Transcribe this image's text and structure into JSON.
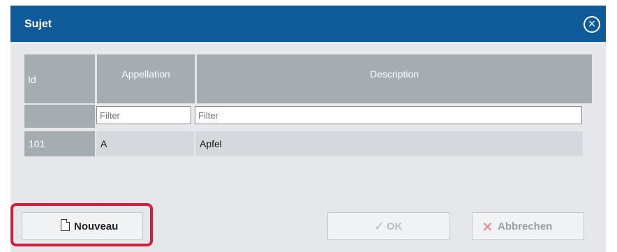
{
  "dialog": {
    "title": "Sujet",
    "close_icon": "close-circle-icon"
  },
  "table": {
    "columns": [
      "Id",
      "Appellation",
      "Description"
    ],
    "filters": [
      {
        "column": "Appellation",
        "placeholder": "Filter"
      },
      {
        "column": "Description",
        "placeholder": "Filter"
      }
    ],
    "rows": [
      {
        "id": "101",
        "appellation": "A",
        "description": "Apfel"
      }
    ]
  },
  "buttons": {
    "new_label": "Nouveau",
    "new_icon": "new-page-icon",
    "ok_label": "OK",
    "ok_icon": "checkmark-icon",
    "cancel_label": "Abbrechen",
    "cancel_icon": "x-icon"
  },
  "colors": {
    "titlebar": "#0f5a98",
    "header_bg": "#a5acb2",
    "highlight": "#d41e3d"
  }
}
